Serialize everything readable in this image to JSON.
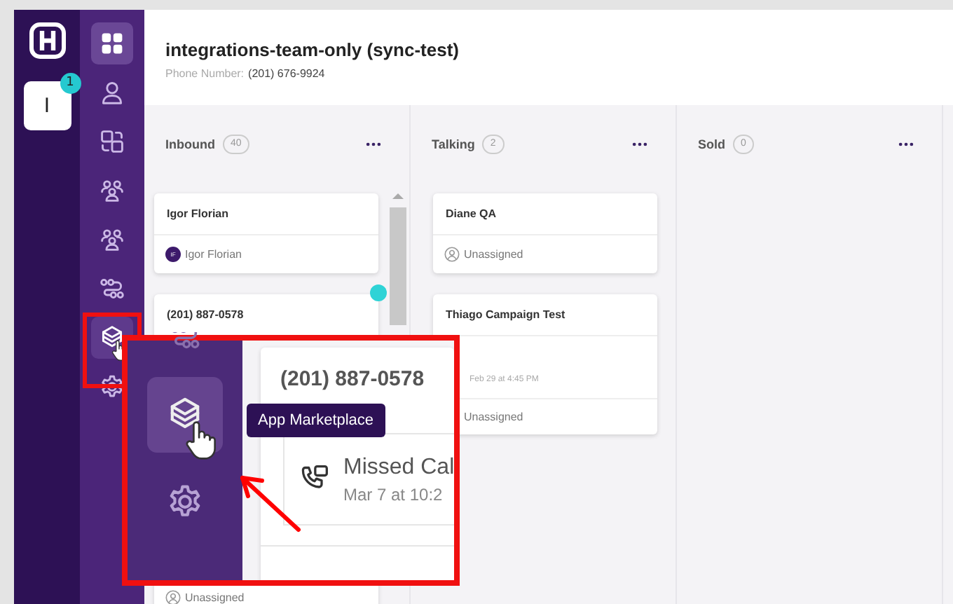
{
  "account": {
    "initial": "I",
    "badge": "1"
  },
  "nav": [
    {
      "kind": "grid",
      "selected": true,
      "hovered": false
    },
    {
      "kind": "person",
      "selected": false,
      "hovered": false
    },
    {
      "kind": "shapes",
      "selected": false,
      "hovered": false
    },
    {
      "kind": "team",
      "selected": false,
      "hovered": false
    },
    {
      "kind": "team",
      "selected": false,
      "hovered": false
    },
    {
      "kind": "flow",
      "selected": false,
      "hovered": false
    },
    {
      "kind": "stack",
      "selected": false,
      "hovered": true
    },
    {
      "kind": "gear",
      "selected": false,
      "hovered": false
    }
  ],
  "header": {
    "title": "integrations-team-only (sync-test)",
    "phone_label": "Phone Number:",
    "phone": "(201) 676-9924"
  },
  "columns": [
    {
      "name": "Inbound",
      "count": "40",
      "scrollable": true,
      "cards": [
        {
          "title": "Igor Florian",
          "unread": false,
          "assigned": true,
          "assignee_initials": "IF",
          "assignee": "Igor Florian"
        },
        {
          "title": "(201) 887-0578",
          "unread": true,
          "assigned": false,
          "assignee": "Unassigned",
          "tall": true
        }
      ]
    },
    {
      "name": "Talking",
      "count": "2",
      "scrollable": false,
      "cards": [
        {
          "title": "Diane QA",
          "unread": false,
          "assigned": false,
          "assignee": "Unassigned"
        },
        {
          "title": "Thiago Campaign Test",
          "unread": false,
          "activity_time": "Feb 29 at 4:45 PM",
          "assignee": "Unassigned"
        }
      ]
    },
    {
      "name": "Sold",
      "count": "0",
      "scrollable": false
    }
  ],
  "callout": {
    "tooltip": "App Marketplace",
    "card_title": "(201) 887-0578",
    "activity_title": "Missed Cal",
    "activity_time": "Mar 7 at 10:2"
  }
}
